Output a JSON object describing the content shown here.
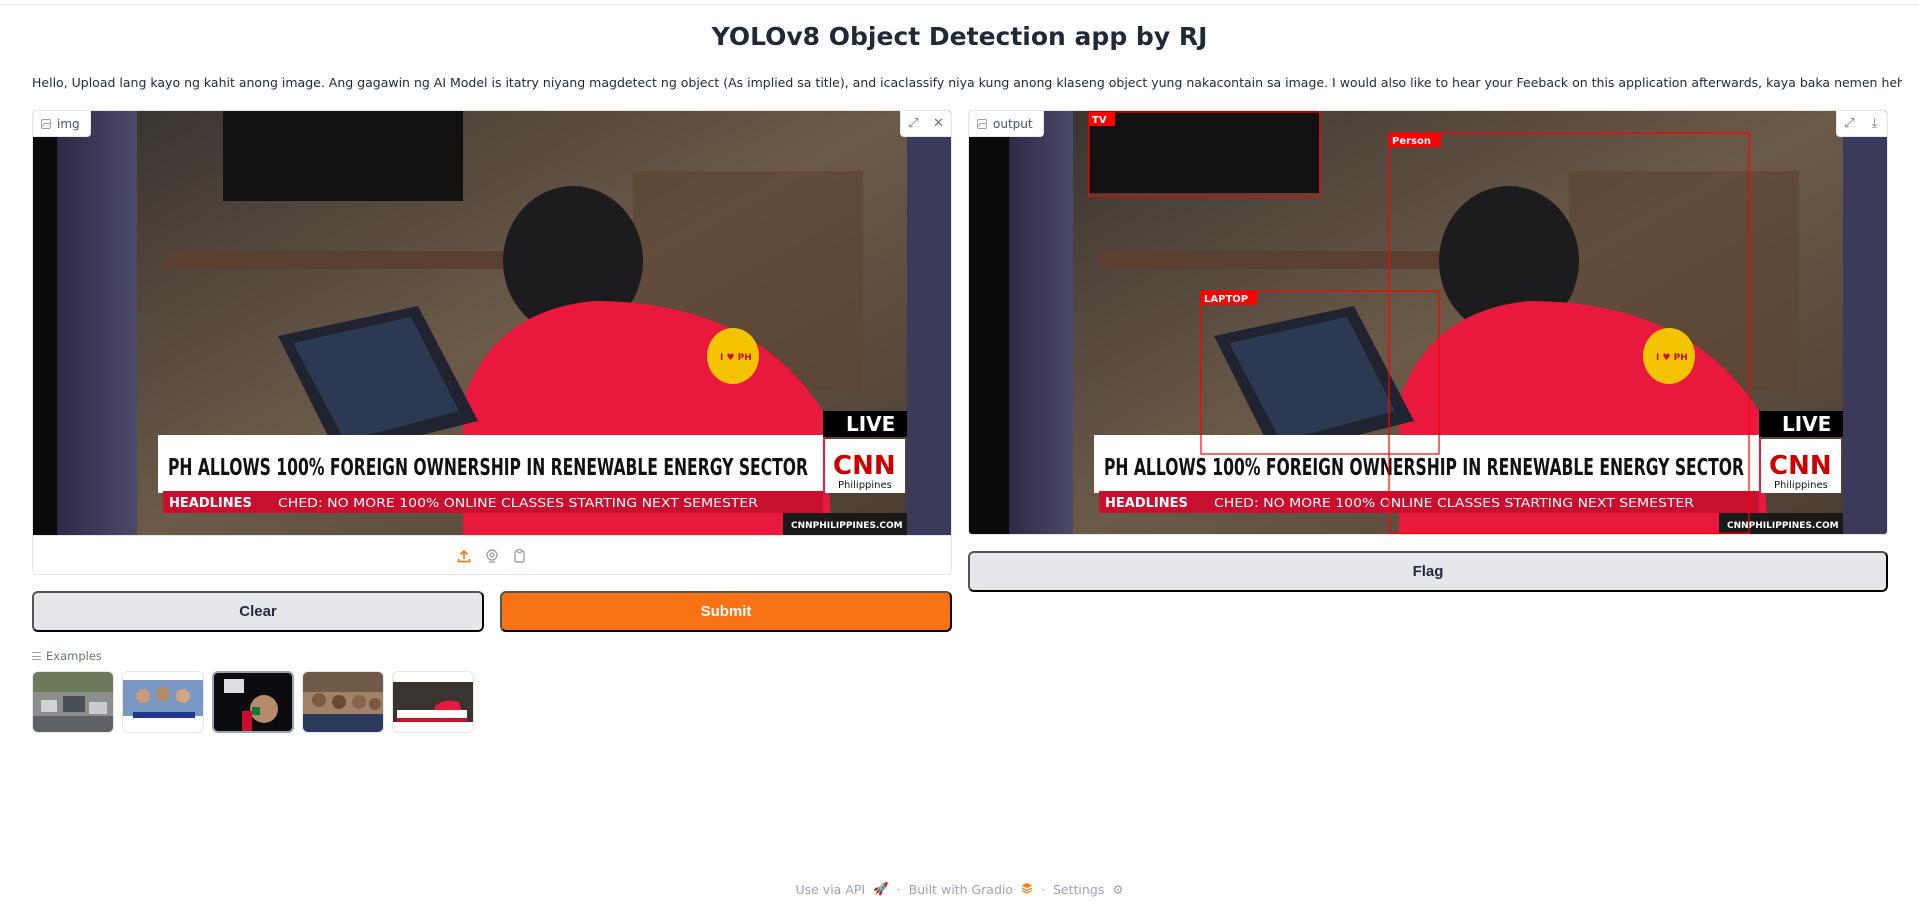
{
  "app": {
    "title": "YOLOv8 Object Detection app by RJ",
    "description": "Hello, Upload lang kayo ng kahit anong image. Ang gagawin ng AI Model is itatry niyang magdetect ng object (As implied sa title), and icaclassify niya kung anong klaseng object yung nakacontain sa image. I would also like to hear your Feeback on this application afterwards, kaya baka nemen hehe, Maraming salamat!!!"
  },
  "input_panel": {
    "label": "img",
    "icons": [
      "image-icon",
      "fullscreen-icon",
      "close-icon"
    ],
    "source_icons": [
      "upload-icon",
      "webcam-icon",
      "clipboard-icon"
    ]
  },
  "output_panel": {
    "label": "output",
    "icons": [
      "image-icon",
      "fullscreen-icon",
      "download-icon"
    ],
    "detections": [
      {
        "label": "TV"
      },
      {
        "label": "Person"
      },
      {
        "label": "LAPTOP"
      }
    ]
  },
  "news_frame": {
    "live": "LIVE",
    "headline": "PH ALLOWS 100% FOREIGN OWNERSHIP IN RENEWABLE ENERGY SECTOR",
    "brand": "CNN",
    "brand_sub": "Philippines",
    "ticker_tag": "HEADLINES",
    "ticker": "CHED: NO MORE 100% ONLINE CLASSES STARTING NEXT SEMESTER",
    "site": "CNNPHILIPPINES.COM",
    "badge": "I ♥ PH"
  },
  "buttons": {
    "clear": "Clear",
    "submit": "Submit",
    "flag": "Flag"
  },
  "examples": {
    "label": "Examples",
    "count": 5,
    "selected_index": 2
  },
  "footer": {
    "api": "Use via API",
    "built": "Built with Gradio",
    "settings": "Settings"
  },
  "colors": {
    "accent": "#f97316",
    "button_secondary": "#e5e7eb",
    "detection_box": "#ff0000"
  }
}
